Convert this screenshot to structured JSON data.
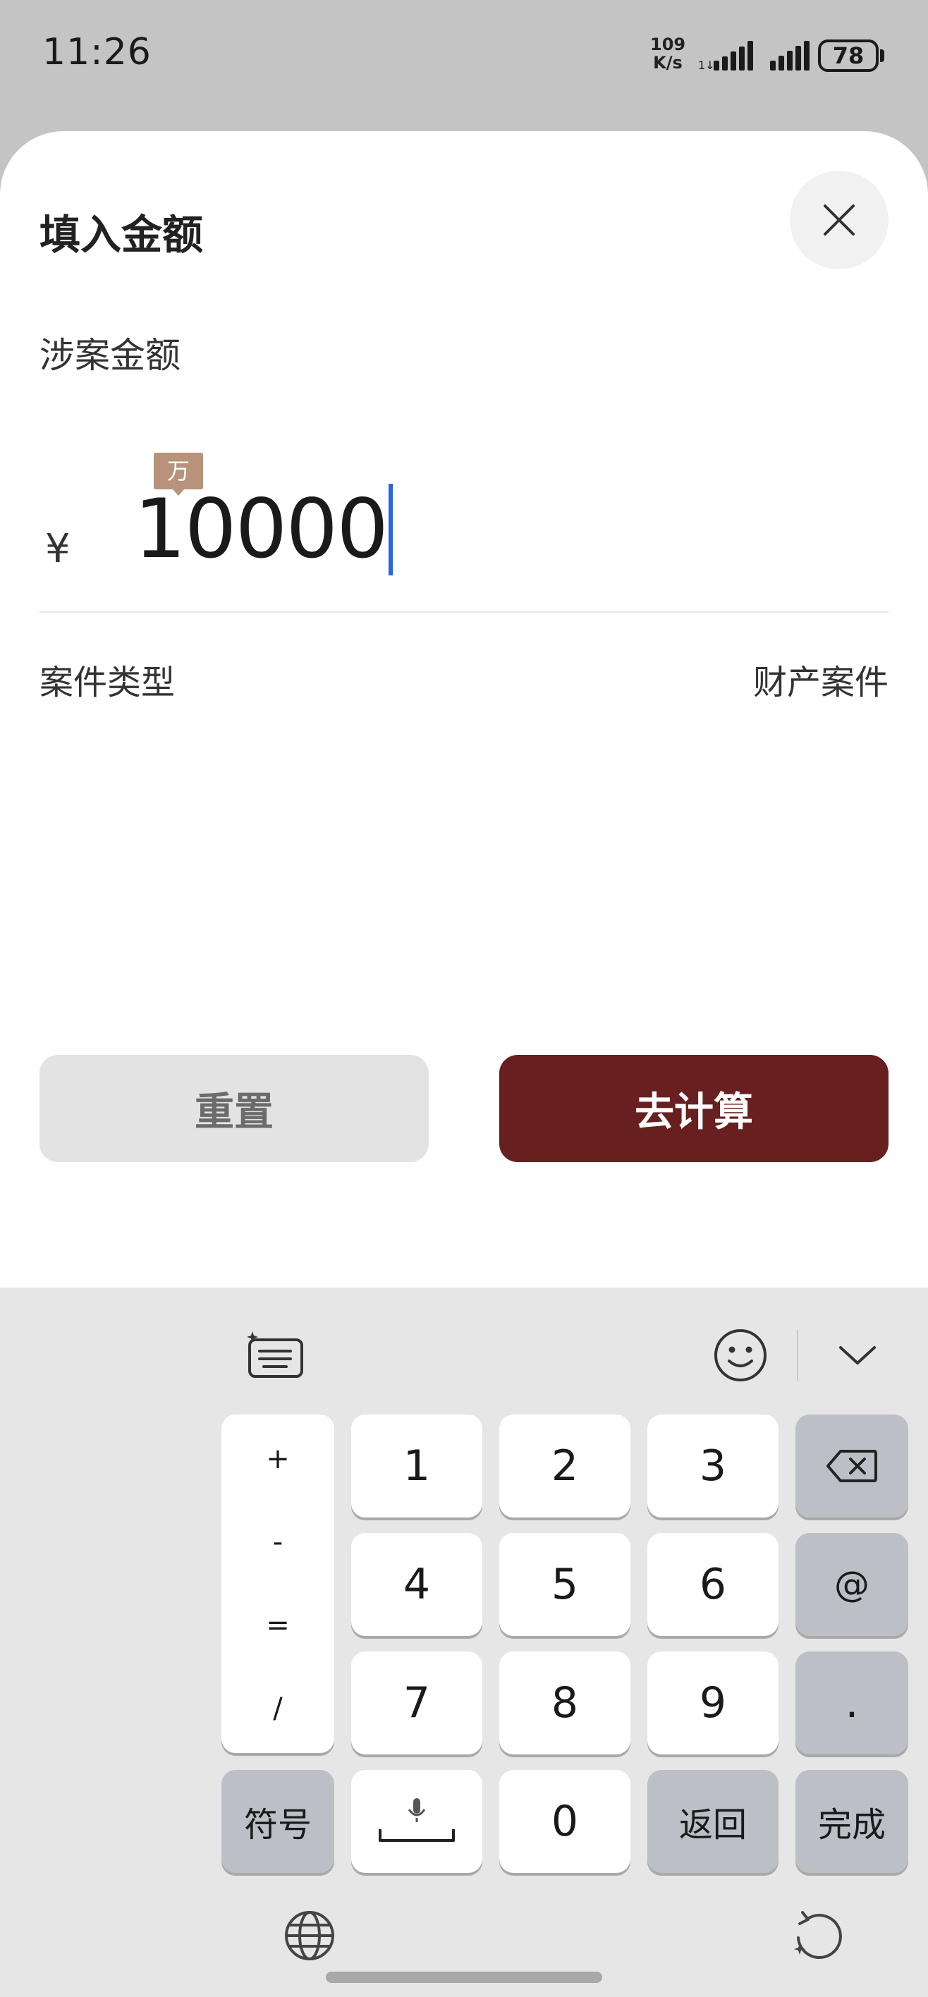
{
  "status_bar": {
    "time": "11:26",
    "net_speed_value": "109",
    "net_speed_unit": "K/s",
    "battery": "78"
  },
  "sheet": {
    "title": "填入金额",
    "amount_label": "涉案金额",
    "unit_badge": "万",
    "currency_symbol": "¥",
    "amount_value": "10000",
    "case_type_label": "案件类型",
    "case_type_value": "财产案件",
    "reset_label": "重置",
    "calculate_label": "去计算",
    "accent_color": "#67201f"
  },
  "keyboard": {
    "symbols": [
      "+",
      "-",
      "=",
      "/"
    ],
    "keys": {
      "k1": "1",
      "k2": "2",
      "k3": "3",
      "k4": "4",
      "k5": "5",
      "k6": "6",
      "k7": "7",
      "k8": "8",
      "k9": "9",
      "k0": "0",
      "at": "@",
      "dot": ".",
      "symbol_switch": "符号",
      "back": "返回",
      "done": "完成"
    },
    "icons": [
      "ai-keyboard-icon",
      "emoji-icon",
      "collapse-icon",
      "backspace-icon",
      "microphone-space-icon",
      "globe-icon",
      "refresh-icon"
    ]
  }
}
